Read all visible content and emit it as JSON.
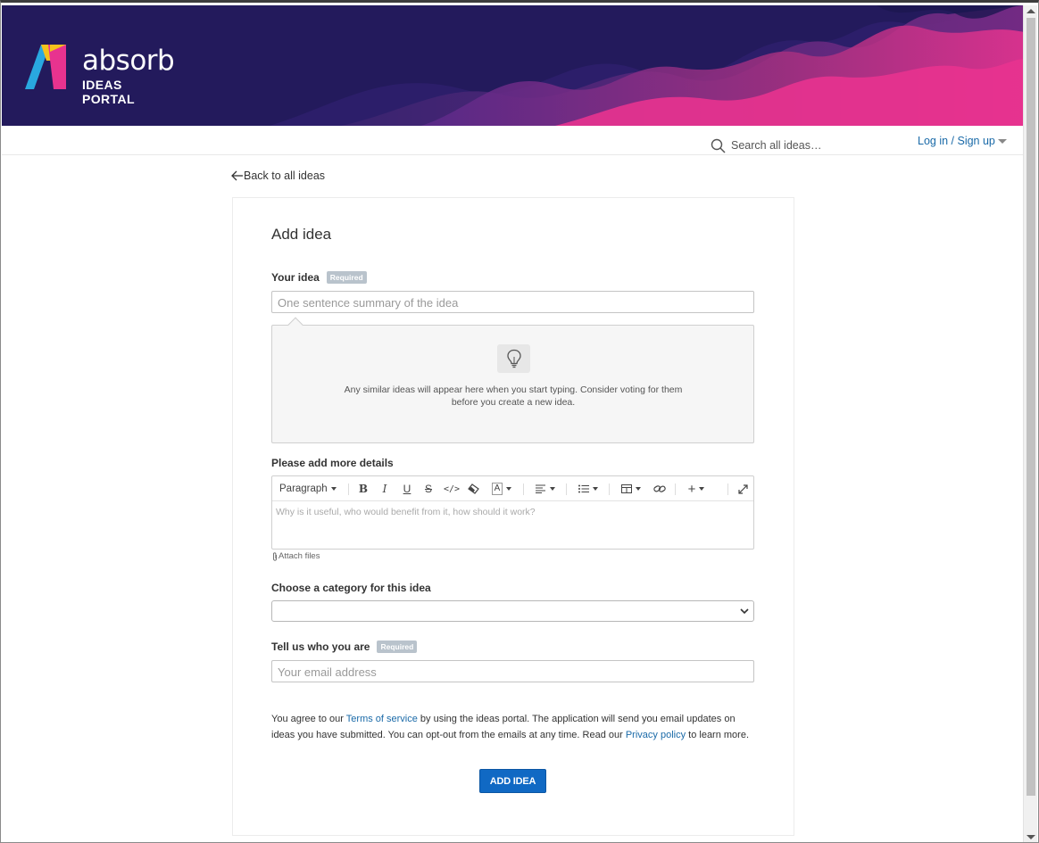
{
  "header": {
    "brand_name": "absorb",
    "brand_subtitle": "IDEAS PORTAL",
    "search_placeholder": "Search all ideas…",
    "login_label": "Log in / Sign up"
  },
  "nav": {
    "back_label": "Back to all ideas"
  },
  "form": {
    "title": "Add idea",
    "idea_label": "Your idea",
    "required_badge": "Required",
    "idea_placeholder": "One sentence summary of the idea",
    "similar_text": "Any similar ideas will appear here when you start typing. Consider voting for them before you create a new idea.",
    "details_label": "Please add more details",
    "toolbar_paragraph": "Paragraph",
    "details_placeholder": "Why is it useful, who would benefit from it, how should it work?",
    "attach_label": "Attach files",
    "category_label": "Choose a category for this idea",
    "category_value": "",
    "who_label": "Tell us who you are",
    "email_placeholder": "Your email address",
    "terms_part1": "You agree to our ",
    "terms_link": "Terms of service",
    "terms_part2": " by using the ideas portal. The application will send you email updates on ideas you have submitted. You can opt-out from the emails at any time. Read our ",
    "privacy_link": "Privacy policy",
    "terms_part3": " to learn more.",
    "submit_label": "ADD IDEA"
  },
  "colors": {
    "banner_bg": "#231a5c",
    "accent_pink": "#e8338f",
    "link_blue": "#1a6aa8",
    "button_blue": "#1069c4"
  }
}
